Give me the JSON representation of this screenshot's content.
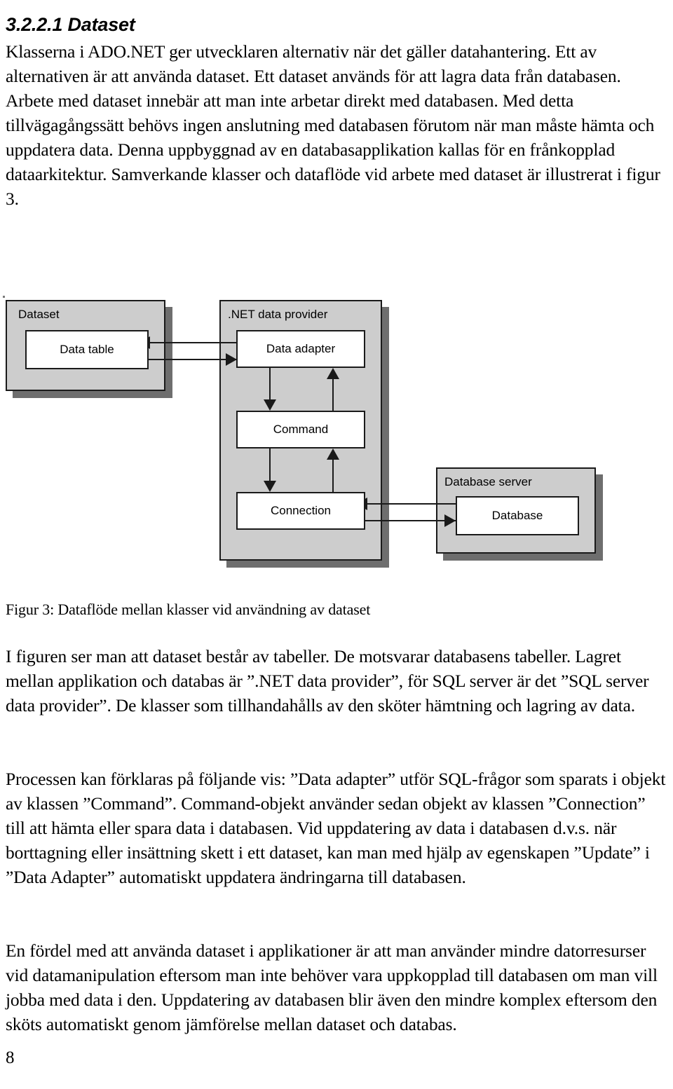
{
  "document": {
    "heading": "3.2.2.1 Dataset",
    "page_number": "8",
    "paragraphs": {
      "intro": "Klasserna i ADO.NET ger utvecklaren alternativ när det gäller datahantering. Ett av alternativen är att använda dataset. Ett dataset används för att lagra data från databasen. Arbete med dataset innebär att man inte arbetar direkt med databasen. Med detta tillvägagångssätt behövs ingen anslutning med databasen förutom när man måste hämta och uppdatera data. Denna uppbyggnad av en databasapplikation kallas för en frånkopplad dataarkitektur. Samverkande klasser och dataflöde vid arbete med dataset är illustrerat i figur 3.",
      "figure_explanation": "I figuren ser man att dataset består av tabeller. De motsvarar databasens tabeller. Lagret mellan applikation och databas är ”.NET data provider”, för SQL server är det ”SQL server data provider”. De klasser som tillhandahålls av den sköter hämtning och lagring av data.",
      "process": "Processen kan förklaras på följande vis: ”Data adapter” utför SQL-frågor som sparats i objekt av klassen ”Command”. Command-objekt använder sedan objekt av klassen ”Connection” till att hämta eller spara data i databasen. Vid uppdatering av data i databasen d.v.s. när borttagning eller insättning skett i ett dataset, kan man med hjälp av egenskapen ”Update” i ”Data Adapter” automatiskt uppdatera ändringarna till databasen.",
      "benefit": "En fördel med att använda dataset i applikationer är att man använder mindre datorresurser vid datamanipulation eftersom man inte behöver vara uppkopplad till databasen om man vill jobba med data i den. Uppdatering av databasen blir även den mindre komplex eftersom den sköts automatiskt genom jämförelse mellan dataset och databas."
    }
  },
  "figure": {
    "caption": "Figur 3: Dataflöde mellan  klasser vid användning av dataset",
    "panels": [
      {
        "id": "dataset",
        "label": "Dataset"
      },
      {
        "id": "provider",
        "label": ".NET data provider"
      },
      {
        "id": "dbserver",
        "label": "Database server"
      }
    ],
    "nodes": [
      {
        "id": "datatable",
        "label": "Data table"
      },
      {
        "id": "adapter",
        "label": "Data adapter"
      },
      {
        "id": "command",
        "label": "Command"
      },
      {
        "id": "connection",
        "label": "Connection"
      },
      {
        "id": "database",
        "label": "Database"
      }
    ],
    "connections": [
      {
        "from": "adapter",
        "to": "datatable",
        "direction": "left"
      },
      {
        "from": "datatable",
        "to": "adapter",
        "direction": "right"
      },
      {
        "from": "adapter",
        "to": "command",
        "direction": "down"
      },
      {
        "from": "command",
        "to": "adapter",
        "direction": "up"
      },
      {
        "from": "command",
        "to": "connection",
        "direction": "down"
      },
      {
        "from": "connection",
        "to": "command",
        "direction": "up"
      },
      {
        "from": "database",
        "to": "connection",
        "direction": "left"
      },
      {
        "from": "connection",
        "to": "database",
        "direction": "right"
      }
    ],
    "colors": {
      "panel_fill": "#cdcdcd",
      "panel_shadow": "#6e6e6e",
      "node_fill": "#ffffff",
      "stroke": "#1a1a1a"
    }
  }
}
